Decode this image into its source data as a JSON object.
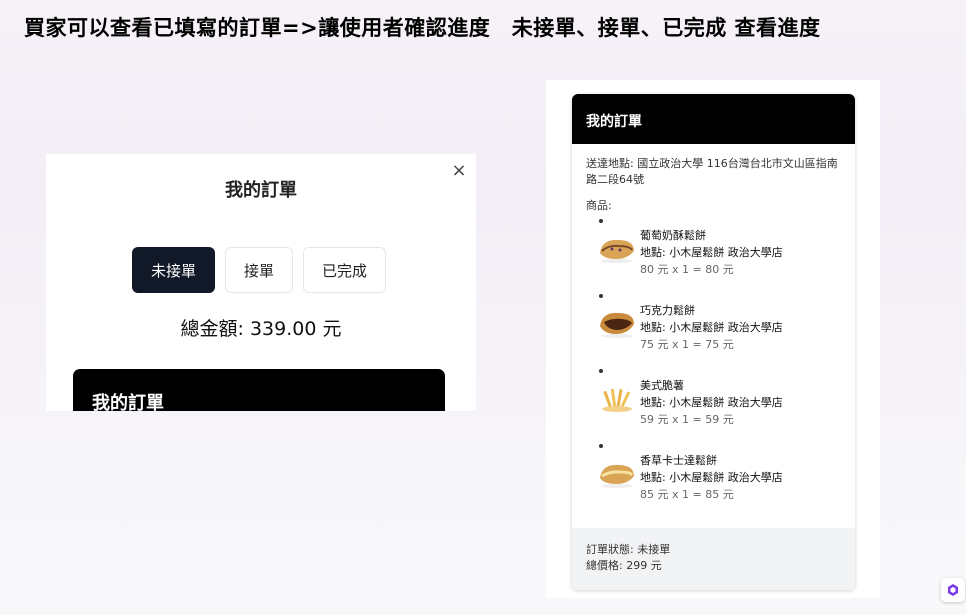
{
  "slide": {
    "title": "買家可以查看已填寫的訂單=>讓使用者確認進度　未接單、接單、已完成 查看進度"
  },
  "left_panel": {
    "close_symbol": "×",
    "heading": "我的訂單",
    "tabs": [
      {
        "label": "未接單",
        "active": true
      },
      {
        "label": "接單",
        "active": false
      },
      {
        "label": "已完成",
        "active": false
      }
    ],
    "total": "總金額: 339.00 元",
    "card_title": "我的訂單"
  },
  "right_panel": {
    "card_title": "我的訂單",
    "address": "送達地點: 國立政治大學 116台灣台北市文山區指南路二段64號",
    "goods_label": "商品:",
    "items": [
      {
        "name": "葡萄奶酥鬆餅",
        "shop": "地點: 小木屋鬆餅 政治大學店",
        "price": "80 元 x 1 = 80 元",
        "icon": "grape-waffle-image"
      },
      {
        "name": "巧克力鬆餅",
        "shop": "地點: 小木屋鬆餅 政治大學店",
        "price": "75 元 x 1 = 75 元",
        "icon": "chocolate-waffle-image"
      },
      {
        "name": "美式脆薯",
        "shop": "地點: 小木屋鬆餅 政治大學店",
        "price": "59 元 x 1 = 59 元",
        "icon": "french-fries-image"
      },
      {
        "name": "香草卡士達鬆餅",
        "shop": "地點: 小木屋鬆餅 政治大學店",
        "price": "85 元 x 1 = 85 元",
        "icon": "custard-waffle-image"
      }
    ],
    "status": "訂單狀態: 未接單",
    "total_price": "總價格: 299 元"
  },
  "colors": {
    "active_tab": "#111827",
    "card_header": "#000000",
    "footer_bg": "#f2f3f5"
  }
}
